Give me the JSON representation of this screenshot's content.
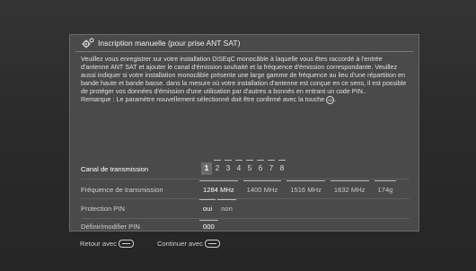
{
  "window": {
    "title": "Inscription manuelle (pour prise ANT SAT)",
    "icon": "satellite-gear-icon"
  },
  "description": "Veuillez vous enregistrer sur votre installation DiSEqC monocâble à laquelle vous êtes raccordé à l'entrée d'antenne ANT SAT et ajouter le canal d'émission souhaité et la fréquence d'émission correspondante. Veuillez aussi indiquer si votre installation monocâble présente une large gamme de fréquence au lieu d'une répartition en bande haute et bande basse. dans la mesure où votre installation d'antenne est conçue en ce sens, il est possible de protéger vos données d'émission d'une utilisation par d'autres a bonnés en entrant un code PIN..",
  "remark": "Remarque : Le paramètre nouvellement sélectionné doit être confirmé avec la touche",
  "remark_end": ".",
  "rows": {
    "channel": {
      "label": "Canal de transmission",
      "options": [
        "1",
        "2",
        "3",
        "4",
        "5",
        "6",
        "7",
        "8"
      ],
      "selected": "1"
    },
    "frequency": {
      "label": "Fréquence de transmission",
      "options": [
        "1284 MHz",
        "1400 MHz",
        "1516 MHz",
        "1632 MHz",
        "174g"
      ],
      "selected": "1284 MHz"
    },
    "pin_protection": {
      "label": "Protection PIN",
      "options": [
        "oui",
        "non"
      ],
      "selected": "oui"
    },
    "pin_set": {
      "label": "Définir/modifier PIN",
      "value": "000"
    }
  },
  "footer": {
    "back": "Retour avec",
    "continue": "Continuer avec"
  }
}
